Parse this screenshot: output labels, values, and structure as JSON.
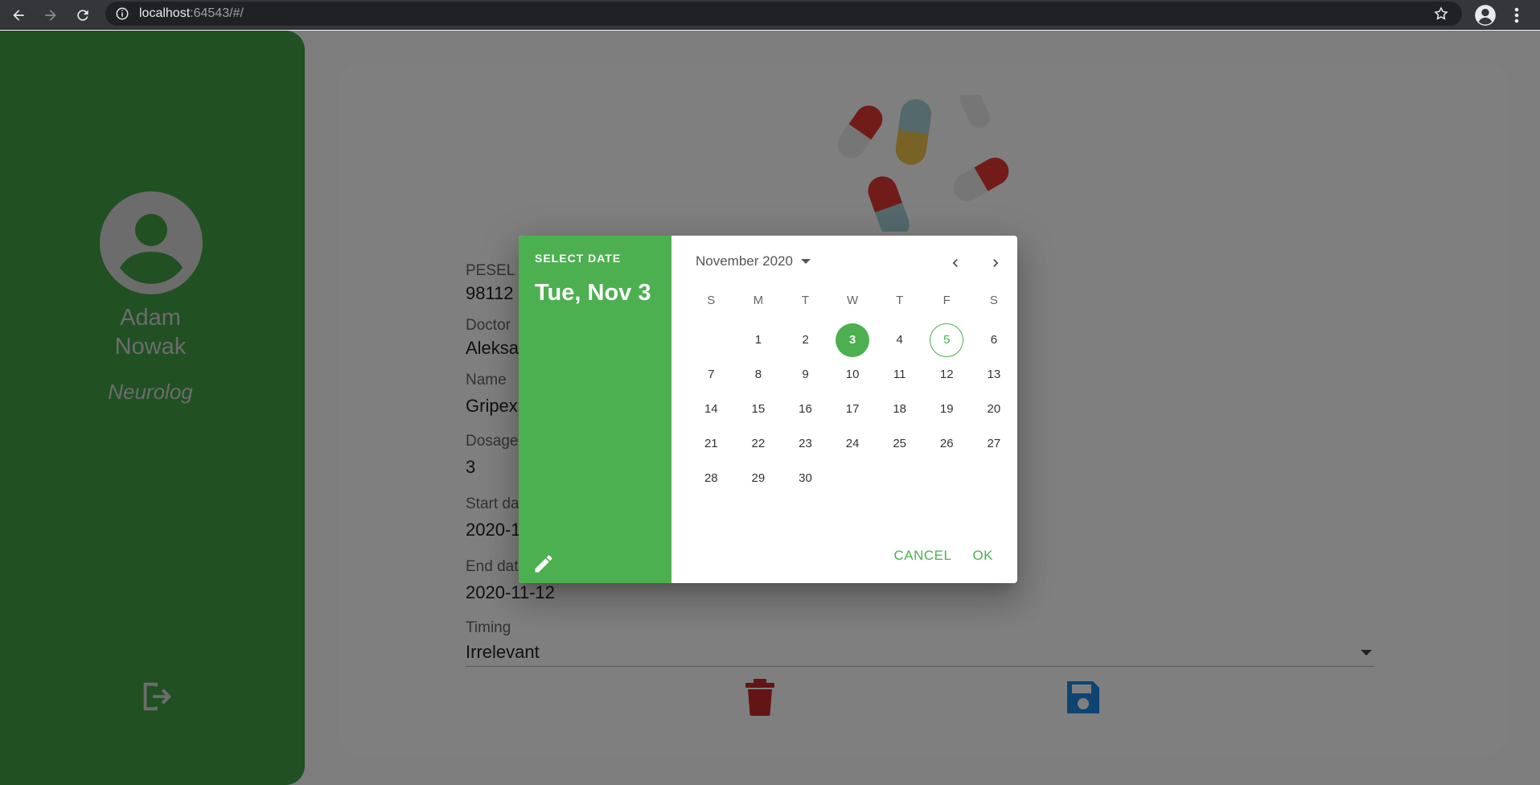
{
  "browser": {
    "url_host": "localhost",
    "url_rest": ":64543/#/"
  },
  "sidebar": {
    "doctor_first_name": "Adam",
    "doctor_last_name": "Nowak",
    "doctor_role": "Neurolog"
  },
  "form": {
    "pesel_label": "PESEL",
    "pesel_value": "98112",
    "doctor_label": "Doctor",
    "doctor_value": "Aleksa",
    "name_label": "Name",
    "name_value": "Gripex",
    "dosage_label": "Dosage",
    "dosage_value": "3",
    "start_label": "Start da",
    "start_value": "2020-1",
    "end_label": "End dat",
    "end_value": "2020-11-12",
    "timing_label": "Timing",
    "timing_value": "Irrelevant"
  },
  "datepicker": {
    "header_label": "SELECT DATE",
    "selected_date": "Tue, Nov 3",
    "month_year": "November 2020",
    "weekdays": [
      "S",
      "M",
      "T",
      "W",
      "T",
      "F",
      "S"
    ],
    "days": [
      "",
      "1",
      "2",
      "3",
      "4",
      "5",
      "6",
      "7",
      "8",
      "9",
      "10",
      "11",
      "12",
      "13",
      "14",
      "15",
      "16",
      "17",
      "18",
      "19",
      "20",
      "21",
      "22",
      "23",
      "24",
      "25",
      "26",
      "27",
      "28",
      "29",
      "30"
    ],
    "selected_day": "3",
    "today_day": "5",
    "cancel_label": "CANCEL",
    "ok_label": "OK"
  },
  "colors": {
    "sidebar_green": "#43a047",
    "accent_green": "#4caf50",
    "delete_red": "#c62828",
    "save_blue": "#1e88e5"
  }
}
